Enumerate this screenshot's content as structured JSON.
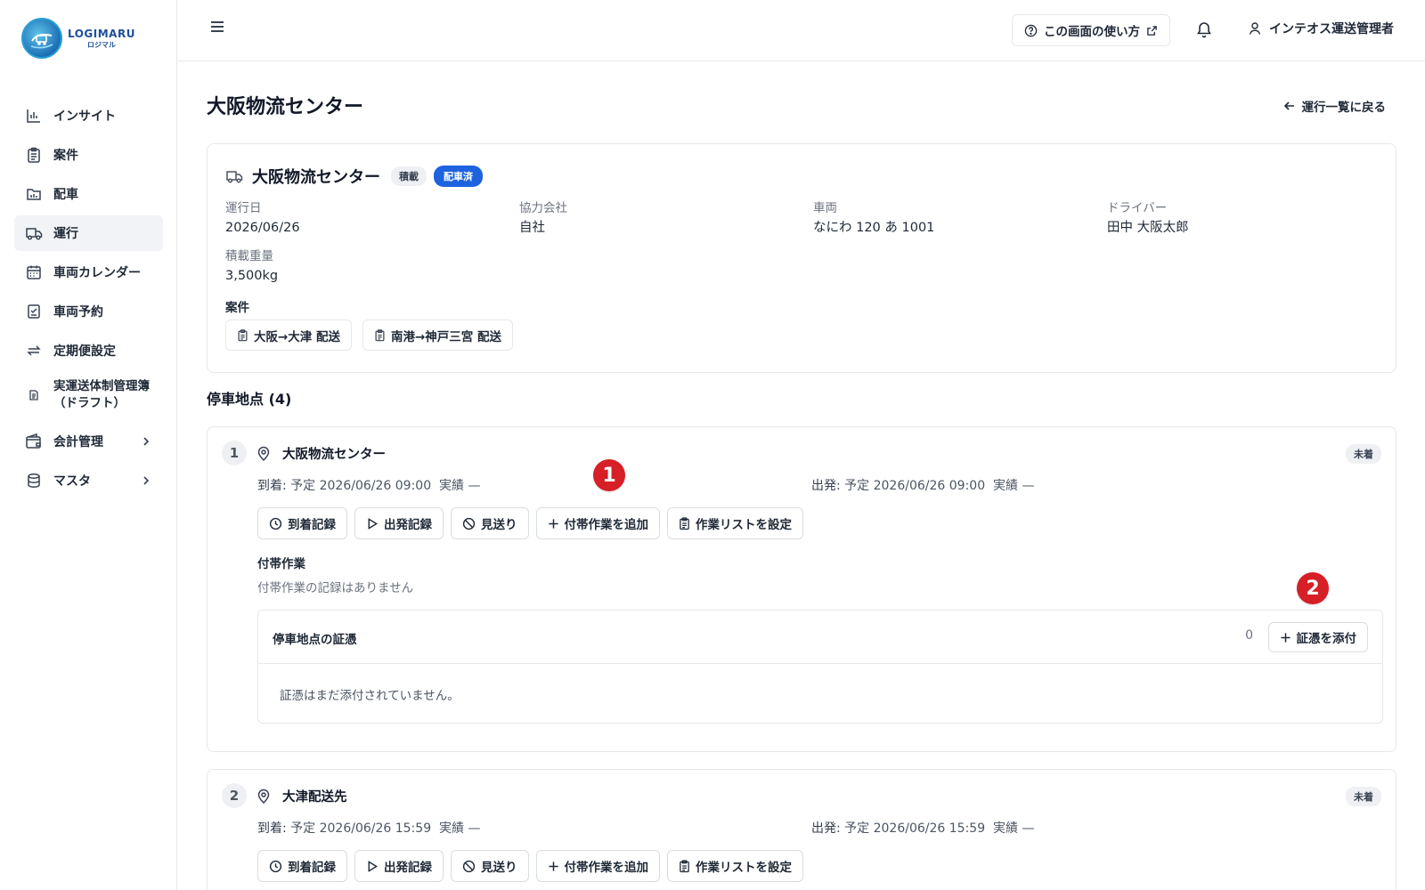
{
  "app": {
    "logo_en": "LOGIMARU",
    "logo_jp": "ロジマル"
  },
  "sidebar": {
    "items": [
      {
        "label": "インサイト",
        "icon": "bar-chart-icon"
      },
      {
        "label": "案件",
        "icon": "clipboard-icon"
      },
      {
        "label": "配車",
        "icon": "folder-chart-icon"
      },
      {
        "label": "運行",
        "icon": "truck-icon",
        "active": true
      },
      {
        "label": "車両カレンダー",
        "icon": "calendar-icon"
      },
      {
        "label": "車両予約",
        "icon": "check-doc-icon"
      },
      {
        "label": "定期便設定",
        "icon": "repeat-icon"
      },
      {
        "label": "実運送体制管理簿\n（ドラフト）",
        "icon": "document-icon"
      },
      {
        "label": "会計管理",
        "icon": "wallet-icon",
        "expandable": true
      },
      {
        "label": "マスタ",
        "icon": "database-icon",
        "expandable": true
      }
    ]
  },
  "topbar": {
    "help_label": "この画面の使い方",
    "user_name": "インテオス運送管理者"
  },
  "page": {
    "title": "大阪物流センター",
    "back_label": "運行一覧に戻る"
  },
  "summary": {
    "title": "大阪物流センター",
    "type_badge": "積載",
    "status_badge": "配車済",
    "fields": {
      "date": {
        "label": "運行日",
        "value": "2026/06/26"
      },
      "partner": {
        "label": "協力会社",
        "value": "自社"
      },
      "vehicle": {
        "label": "車両",
        "value": "なにわ 120 あ 1001"
      },
      "driver": {
        "label": "ドライバー",
        "value": "田中 大阪太郎"
      },
      "weight": {
        "label": "積載重量",
        "value": "3,500kg"
      }
    },
    "cases_label": "案件",
    "cases": [
      "大阪→大津 配送",
      "南港→神戸三宮 配送"
    ]
  },
  "stops": {
    "title": "停車地点 (4)",
    "items": [
      {
        "num": "1",
        "name": "大阪物流センター",
        "status": "未着",
        "arrival_label": "到着:",
        "arrival_planned": "予定 2026/06/26 09:00",
        "arrival_actual": "実績 —",
        "departure_label": "出発:",
        "departure_planned": "予定 2026/06/26 09:00",
        "departure_actual": "実績 —",
        "actions": [
          "到着記録",
          "出発記録",
          "見送り",
          "付帯作業を追加",
          "作業リストを設定"
        ],
        "sub_title": "付帯作業",
        "sub_empty": "付帯作業の記録はありません",
        "evidence_title": "停車地点の証憑",
        "evidence_count": "0",
        "evidence_attach": "証憑を添付",
        "evidence_empty": "証憑はまだ添付されていません。"
      },
      {
        "num": "2",
        "name": "大津配送先",
        "status": "未着",
        "arrival_label": "到着:",
        "arrival_planned": "予定 2026/06/26 15:59",
        "arrival_actual": "実績 —",
        "departure_label": "出発:",
        "departure_planned": "予定 2026/06/26 15:59",
        "departure_actual": "実績 —",
        "actions": [
          "到着記録",
          "出発記録",
          "見送り",
          "付帯作業を追加",
          "作業リストを設定"
        ]
      }
    ]
  },
  "annotations": [
    "1",
    "2"
  ],
  "colors": {
    "accent_blue": "#1d63e0",
    "marker_red": "#d61f26",
    "active_nav_bg": "#f1f3f6"
  }
}
